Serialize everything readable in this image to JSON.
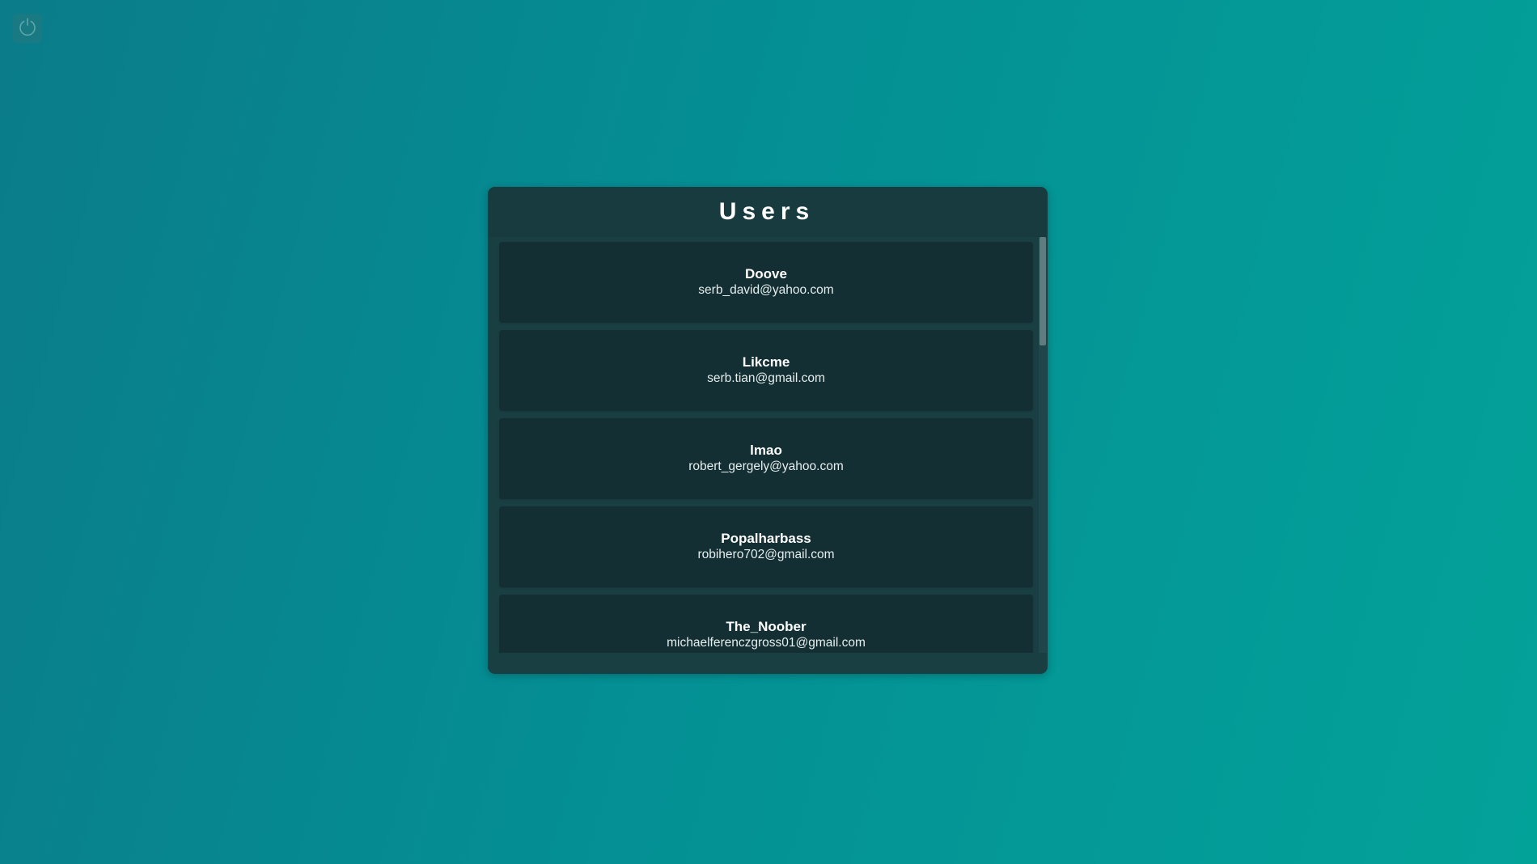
{
  "icons": {
    "power": "power-icon"
  },
  "panel": {
    "title": "Users"
  },
  "users": [
    {
      "name": "Doove",
      "email": "serb_david@yahoo.com"
    },
    {
      "name": "Likcme",
      "email": "serb.tian@gmail.com"
    },
    {
      "name": "lmao",
      "email": "robert_gergely@yahoo.com"
    },
    {
      "name": "Popalharbass",
      "email": "robihero702@gmail.com"
    },
    {
      "name": "The_Noober",
      "email": "michaelferenczgross01@gmail.com"
    }
  ],
  "colors": {
    "background_start": "#0b7c8a",
    "background_end": "#03a299",
    "panel": "#1a3f43",
    "row": "#132f33"
  }
}
